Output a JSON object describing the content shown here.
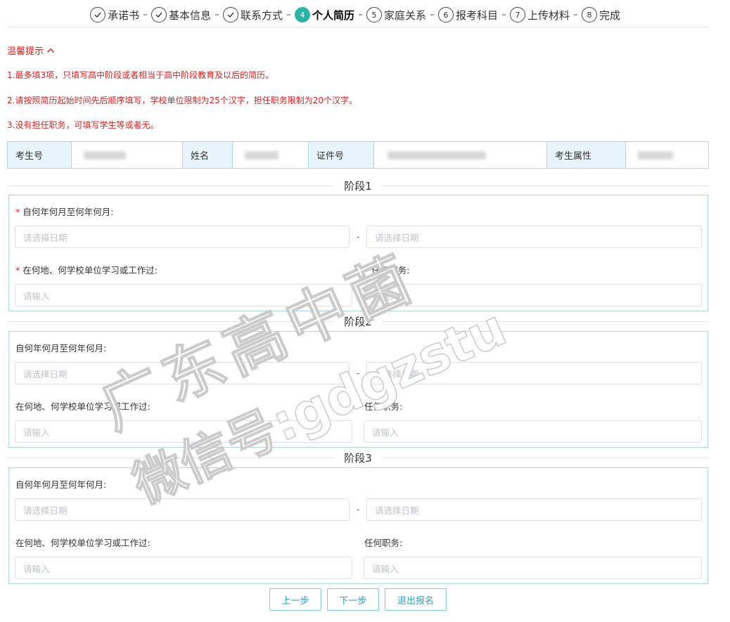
{
  "steps": [
    {
      "label": "承诺书",
      "state": "done"
    },
    {
      "label": "基本信息",
      "state": "done"
    },
    {
      "label": "联系方式",
      "state": "done"
    },
    {
      "label": "个人简历",
      "state": "active",
      "num": "4"
    },
    {
      "label": "家庭关系",
      "state": "todo",
      "num": "5"
    },
    {
      "label": "报考科目",
      "state": "todo",
      "num": "6"
    },
    {
      "label": "上传材料",
      "state": "todo",
      "num": "7"
    },
    {
      "label": "完成",
      "state": "todo",
      "num": "8"
    }
  ],
  "tips": {
    "title": "温馨提示",
    "items": [
      "1.最多填3项，只填写高中阶段或者相当于高中阶段教育及以后的简历。",
      "2.请按照简历起始时间先后顺序填写，学校单位限制为25个汉字，担任职务限制为20个汉字。",
      "3.没有担任职务，可填写学生等或者无。"
    ]
  },
  "info": {
    "exam_no_label": "考生号",
    "name_label": "姓名",
    "id_label": "证件号",
    "attr_label": "考生属性"
  },
  "stages": [
    {
      "title": "阶段1",
      "required": true,
      "date_label": "自何年何月至何年何月:",
      "place_label": "在何地、何学校单位学习或工作过:",
      "duty_label": "任何职务:",
      "date_start_placeholder": "请选择日期",
      "date_end_placeholder": "请选择日期",
      "place_placeholder": "请输入",
      "duty_placeholder": "请输入",
      "dash": "-"
    },
    {
      "title": "阶段2",
      "required": false,
      "date_label": "自何年何月至何年何月:",
      "place_label": "在何地、何学校单位学习或工作过:",
      "duty_label": "任何职务:",
      "date_start_placeholder": "请选择日期",
      "date_end_placeholder": "请选择日期",
      "place_placeholder": "请输入",
      "duty_placeholder": "请输入",
      "dash": "-"
    },
    {
      "title": "阶段3",
      "required": false,
      "date_label": "自何年何月至何年何月:",
      "place_label": "在何地、何学校单位学习或工作过:",
      "duty_label": "任何职务:",
      "date_start_placeholder": "请选择日期",
      "date_end_placeholder": "请选择日期",
      "place_placeholder": "请输入",
      "duty_placeholder": "请输入",
      "dash": "-"
    }
  ],
  "buttons": {
    "prev": "上一步",
    "next": "下一步",
    "exit": "退出报名"
  },
  "watermark": {
    "line1": "广东高中菌",
    "line2": "微信号:gdgzstu"
  },
  "colors": {
    "accent": "#2bb3a6",
    "warning": "#e02020",
    "border": "#a9d6e8",
    "button_text": "#2f9fc4"
  }
}
